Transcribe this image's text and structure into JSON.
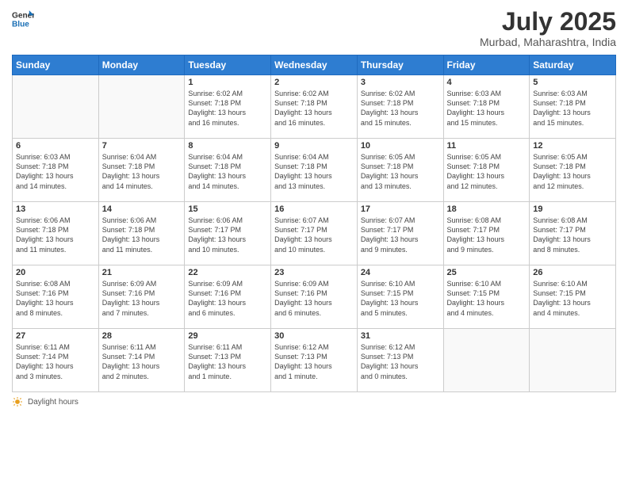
{
  "logo": {
    "line1": "General",
    "line2": "Blue"
  },
  "title": "July 2025",
  "subtitle": "Murbad, Maharashtra, India",
  "days_of_week": [
    "Sunday",
    "Monday",
    "Tuesday",
    "Wednesday",
    "Thursday",
    "Friday",
    "Saturday"
  ],
  "weeks": [
    [
      {
        "day": "",
        "info": ""
      },
      {
        "day": "",
        "info": ""
      },
      {
        "day": "1",
        "info": "Sunrise: 6:02 AM\nSunset: 7:18 PM\nDaylight: 13 hours\nand 16 minutes."
      },
      {
        "day": "2",
        "info": "Sunrise: 6:02 AM\nSunset: 7:18 PM\nDaylight: 13 hours\nand 16 minutes."
      },
      {
        "day": "3",
        "info": "Sunrise: 6:02 AM\nSunset: 7:18 PM\nDaylight: 13 hours\nand 15 minutes."
      },
      {
        "day": "4",
        "info": "Sunrise: 6:03 AM\nSunset: 7:18 PM\nDaylight: 13 hours\nand 15 minutes."
      },
      {
        "day": "5",
        "info": "Sunrise: 6:03 AM\nSunset: 7:18 PM\nDaylight: 13 hours\nand 15 minutes."
      }
    ],
    [
      {
        "day": "6",
        "info": "Sunrise: 6:03 AM\nSunset: 7:18 PM\nDaylight: 13 hours\nand 14 minutes."
      },
      {
        "day": "7",
        "info": "Sunrise: 6:04 AM\nSunset: 7:18 PM\nDaylight: 13 hours\nand 14 minutes."
      },
      {
        "day": "8",
        "info": "Sunrise: 6:04 AM\nSunset: 7:18 PM\nDaylight: 13 hours\nand 14 minutes."
      },
      {
        "day": "9",
        "info": "Sunrise: 6:04 AM\nSunset: 7:18 PM\nDaylight: 13 hours\nand 13 minutes."
      },
      {
        "day": "10",
        "info": "Sunrise: 6:05 AM\nSunset: 7:18 PM\nDaylight: 13 hours\nand 13 minutes."
      },
      {
        "day": "11",
        "info": "Sunrise: 6:05 AM\nSunset: 7:18 PM\nDaylight: 13 hours\nand 12 minutes."
      },
      {
        "day": "12",
        "info": "Sunrise: 6:05 AM\nSunset: 7:18 PM\nDaylight: 13 hours\nand 12 minutes."
      }
    ],
    [
      {
        "day": "13",
        "info": "Sunrise: 6:06 AM\nSunset: 7:18 PM\nDaylight: 13 hours\nand 11 minutes."
      },
      {
        "day": "14",
        "info": "Sunrise: 6:06 AM\nSunset: 7:18 PM\nDaylight: 13 hours\nand 11 minutes."
      },
      {
        "day": "15",
        "info": "Sunrise: 6:06 AM\nSunset: 7:17 PM\nDaylight: 13 hours\nand 10 minutes."
      },
      {
        "day": "16",
        "info": "Sunrise: 6:07 AM\nSunset: 7:17 PM\nDaylight: 13 hours\nand 10 minutes."
      },
      {
        "day": "17",
        "info": "Sunrise: 6:07 AM\nSunset: 7:17 PM\nDaylight: 13 hours\nand 9 minutes."
      },
      {
        "day": "18",
        "info": "Sunrise: 6:08 AM\nSunset: 7:17 PM\nDaylight: 13 hours\nand 9 minutes."
      },
      {
        "day": "19",
        "info": "Sunrise: 6:08 AM\nSunset: 7:17 PM\nDaylight: 13 hours\nand 8 minutes."
      }
    ],
    [
      {
        "day": "20",
        "info": "Sunrise: 6:08 AM\nSunset: 7:16 PM\nDaylight: 13 hours\nand 8 minutes."
      },
      {
        "day": "21",
        "info": "Sunrise: 6:09 AM\nSunset: 7:16 PM\nDaylight: 13 hours\nand 7 minutes."
      },
      {
        "day": "22",
        "info": "Sunrise: 6:09 AM\nSunset: 7:16 PM\nDaylight: 13 hours\nand 6 minutes."
      },
      {
        "day": "23",
        "info": "Sunrise: 6:09 AM\nSunset: 7:16 PM\nDaylight: 13 hours\nand 6 minutes."
      },
      {
        "day": "24",
        "info": "Sunrise: 6:10 AM\nSunset: 7:15 PM\nDaylight: 13 hours\nand 5 minutes."
      },
      {
        "day": "25",
        "info": "Sunrise: 6:10 AM\nSunset: 7:15 PM\nDaylight: 13 hours\nand 4 minutes."
      },
      {
        "day": "26",
        "info": "Sunrise: 6:10 AM\nSunset: 7:15 PM\nDaylight: 13 hours\nand 4 minutes."
      }
    ],
    [
      {
        "day": "27",
        "info": "Sunrise: 6:11 AM\nSunset: 7:14 PM\nDaylight: 13 hours\nand 3 minutes."
      },
      {
        "day": "28",
        "info": "Sunrise: 6:11 AM\nSunset: 7:14 PM\nDaylight: 13 hours\nand 2 minutes."
      },
      {
        "day": "29",
        "info": "Sunrise: 6:11 AM\nSunset: 7:13 PM\nDaylight: 13 hours\nand 1 minute."
      },
      {
        "day": "30",
        "info": "Sunrise: 6:12 AM\nSunset: 7:13 PM\nDaylight: 13 hours\nand 1 minute."
      },
      {
        "day": "31",
        "info": "Sunrise: 6:12 AM\nSunset: 7:13 PM\nDaylight: 13 hours\nand 0 minutes."
      },
      {
        "day": "",
        "info": ""
      },
      {
        "day": "",
        "info": ""
      }
    ]
  ],
  "footer": {
    "daylight_label": "Daylight hours"
  }
}
